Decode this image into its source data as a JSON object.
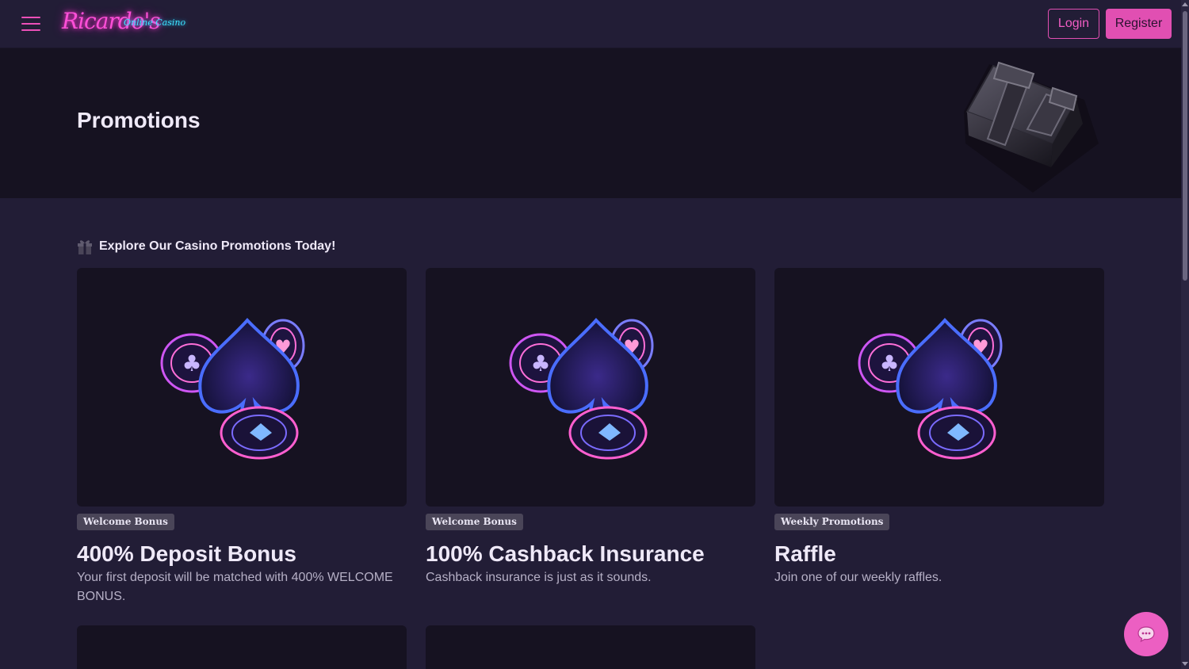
{
  "header": {
    "logo_script": "Ricardo's",
    "logo_sub": "Online Casino",
    "login_label": "Login",
    "register_label": "Register",
    "menu_icon": "hamburger-menu-icon"
  },
  "banner": {
    "title": "Promotions",
    "art_icon": "gift-box-icon"
  },
  "section": {
    "heading": "Explore Our Casino Promotions Today!",
    "icon": "gift-icon"
  },
  "promotions": [
    {
      "tag": "Welcome Bonus",
      "title": "400% Deposit Bonus",
      "description": "Your first deposit will be matched with 400% WELCOME BONUS."
    },
    {
      "tag": "Welcome Bonus",
      "title": "100% Cashback Insurance",
      "description": "Cashback insurance is just as it sounds."
    },
    {
      "tag": "Weekly Promotions",
      "title": "Raffle",
      "description": "Join one of our weekly raffles."
    }
  ],
  "chat": {
    "icon": "chat-bubble-icon"
  },
  "colors": {
    "accent": "#e14fb2",
    "background": "#221d36",
    "panel": "#161221",
    "neon_blue": "#3b6bff",
    "neon_pink": "#ff4fd8"
  }
}
